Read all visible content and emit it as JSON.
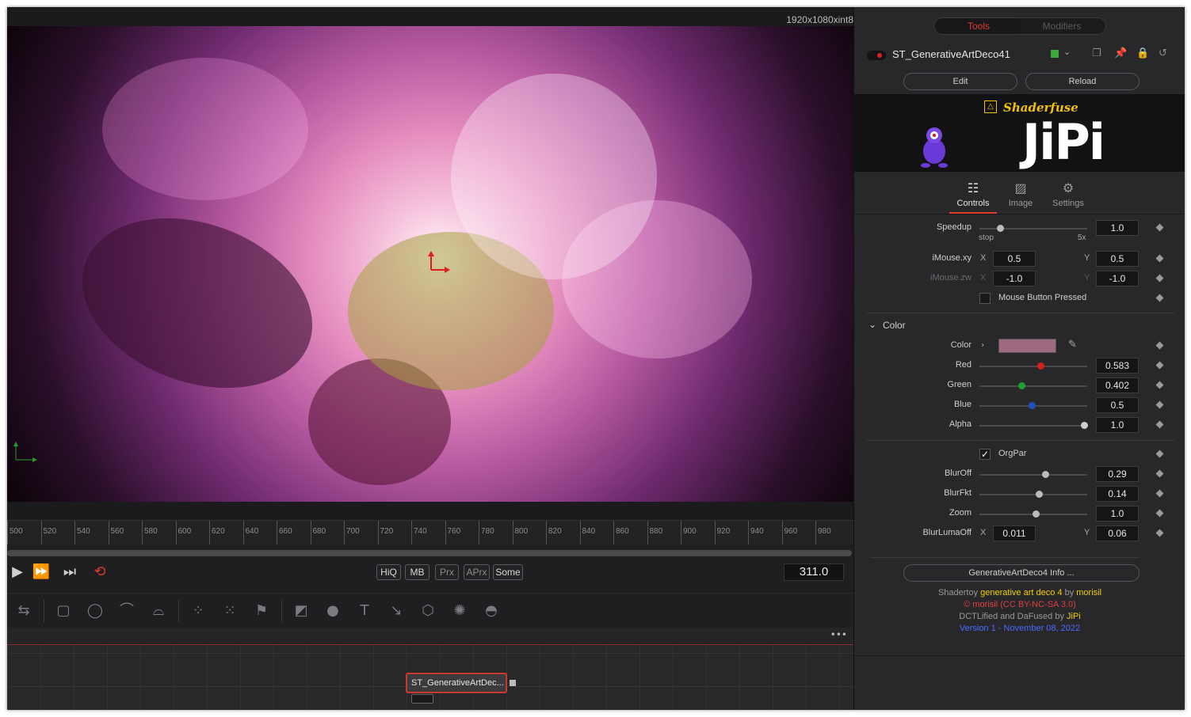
{
  "viewer": {
    "resolution": "1920x1080xint8"
  },
  "timeline": {
    "ticks": [
      "500",
      "520",
      "540",
      "560",
      "580",
      "600",
      "620",
      "640",
      "660",
      "680",
      "700",
      "720",
      "740",
      "760",
      "780",
      "800",
      "820",
      "840",
      "860",
      "880",
      "900",
      "920",
      "940",
      "960",
      "980"
    ]
  },
  "transport": {
    "buttons": [
      "HiQ",
      "MB",
      "Prx",
      "APrx",
      "Some"
    ],
    "frame": "311.0"
  },
  "flow": {
    "node_label": "ST_GenerativeArtDec..."
  },
  "inspector": {
    "tabs": {
      "tools": "Tools",
      "modifiers": "Modifiers"
    },
    "node_name": "ST_GenerativeArtDeco41",
    "edit_label": "Edit",
    "reload_label": "Reload",
    "banner": {
      "brand": "Shaderfuse",
      "author": "JiPi"
    },
    "panel_tabs": [
      "Controls",
      "Image",
      "Settings"
    ],
    "speedup": {
      "label": "Speedup",
      "value": "1.0",
      "min": "stop",
      "max": "5x",
      "fraction": 0.2
    },
    "imouse_xy": {
      "label": "iMouse.xy",
      "x_label": "X",
      "x": "0.5",
      "y_label": "Y",
      "y": "0.5"
    },
    "imouse_zw": {
      "label": "iMouse.zw",
      "x_label": "X",
      "x": "-1.0",
      "y_label": "Y",
      "y": "-1.0"
    },
    "mouse_pressed": "Mouse Button Pressed",
    "color_section": "Color",
    "color_label": "Color",
    "swatch": "#9e6a80",
    "red": {
      "label": "Red",
      "value": "0.583",
      "fraction": 0.583,
      "color": "#d42020"
    },
    "green": {
      "label": "Green",
      "value": "0.402",
      "fraction": 0.402,
      "color": "#20a030"
    },
    "blue": {
      "label": "Blue",
      "value": "0.5",
      "fraction": 0.5,
      "color": "#2050c0"
    },
    "alpha": {
      "label": "Alpha",
      "value": "1.0",
      "fraction": 1.0,
      "color": "#cfcfcf"
    },
    "orgpar": "OrgPar",
    "bluroff": {
      "label": "BlurOff",
      "value": "0.29",
      "fraction": 0.63
    },
    "blurfkt": {
      "label": "BlurFkt",
      "value": "0.14",
      "fraction": 0.57
    },
    "zoom": {
      "label": "Zoom",
      "value": "1.0",
      "fraction": 0.54
    },
    "blurlumaoff": {
      "label": "BlurLumaOff",
      "x_label": "X",
      "x": "0.011",
      "y_label": "Y",
      "y": "0.06"
    },
    "info_button": "GenerativeArtDeco4 Info ...",
    "credits": {
      "line1_a": "Shadertoy ",
      "line1_b": "generative art deco 4",
      "line1_c": " by ",
      "line1_d": "morisil",
      "line2": "© morisil (CC BY-NC-SA 3.0)",
      "line3_a": "DCTLified and DaFused by ",
      "line3_b": "JiPi",
      "line4": "Version 1 - November 08, 2022"
    }
  }
}
